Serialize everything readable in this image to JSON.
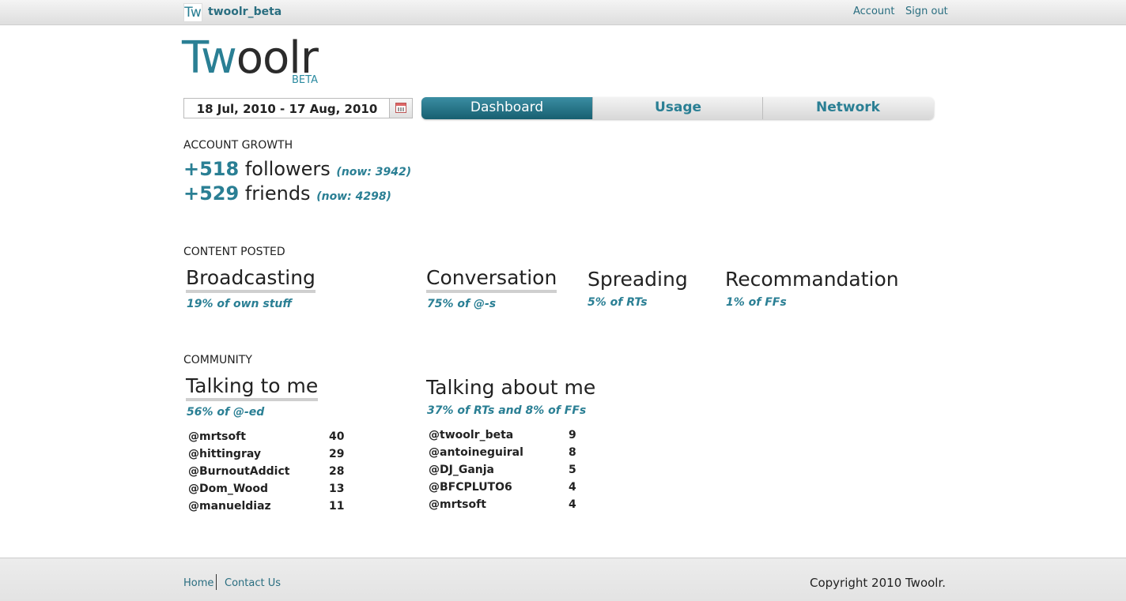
{
  "topbar": {
    "logo_text": "Tw",
    "username": "twoolr_beta",
    "account_link": "Account",
    "signout_link": "Sign out"
  },
  "brand": {
    "name_part1": "Tw",
    "name_part2": "oolr",
    "badge": "BETA"
  },
  "daterange": {
    "value": "18 Jul, 2010 - 17 Aug, 2010"
  },
  "tabs": [
    {
      "label": "Dashboard",
      "active": true
    },
    {
      "label": "Usage",
      "active": false
    },
    {
      "label": "Network",
      "active": false
    }
  ],
  "account_growth": {
    "title": "ACCOUNT GROWTH",
    "followers": {
      "delta": "+518",
      "label": "followers",
      "now": "(now: 3942)"
    },
    "friends": {
      "delta": "+529",
      "label": "friends",
      "now": "(now: 4298)"
    }
  },
  "content_posted": {
    "title": "CONTENT POSTED",
    "categories": [
      {
        "name": "Broadcasting",
        "detail": "19% of own stuff"
      },
      {
        "name": "Conversation",
        "detail": "75% of @-s"
      },
      {
        "name": "Spreading",
        "detail": "5% of RTs"
      },
      {
        "name": "Recommandation",
        "detail": "1% of FFs"
      }
    ]
  },
  "community": {
    "title": "COMMUNITY",
    "talking_to_me": {
      "name": "Talking to me",
      "detail": "56% of @-ed",
      "rows": [
        {
          "user": "@mrtsoft",
          "count": "40"
        },
        {
          "user": "@hittingray",
          "count": "29"
        },
        {
          "user": "@BurnoutAddict",
          "count": "28"
        },
        {
          "user": "@Dom_Wood",
          "count": "13"
        },
        {
          "user": "@manueldiaz",
          "count": "11"
        }
      ]
    },
    "talking_about_me": {
      "name": "Talking about me",
      "detail": "37% of RTs and 8% of FFs",
      "rows": [
        {
          "user": "@twoolr_beta",
          "count": "9"
        },
        {
          "user": "@antoineguiral",
          "count": "8"
        },
        {
          "user": "@DJ_Ganja",
          "count": "5"
        },
        {
          "user": "@BFCPLUTO6",
          "count": "4"
        },
        {
          "user": "@mrtsoft",
          "count": "4"
        }
      ]
    }
  },
  "footer": {
    "home": "Home",
    "contact": "Contact Us",
    "copyright": "Copyright 2010 Twoolr."
  },
  "colors": {
    "accent": "#2a7f94",
    "tab_active": "#1f6a7c"
  }
}
